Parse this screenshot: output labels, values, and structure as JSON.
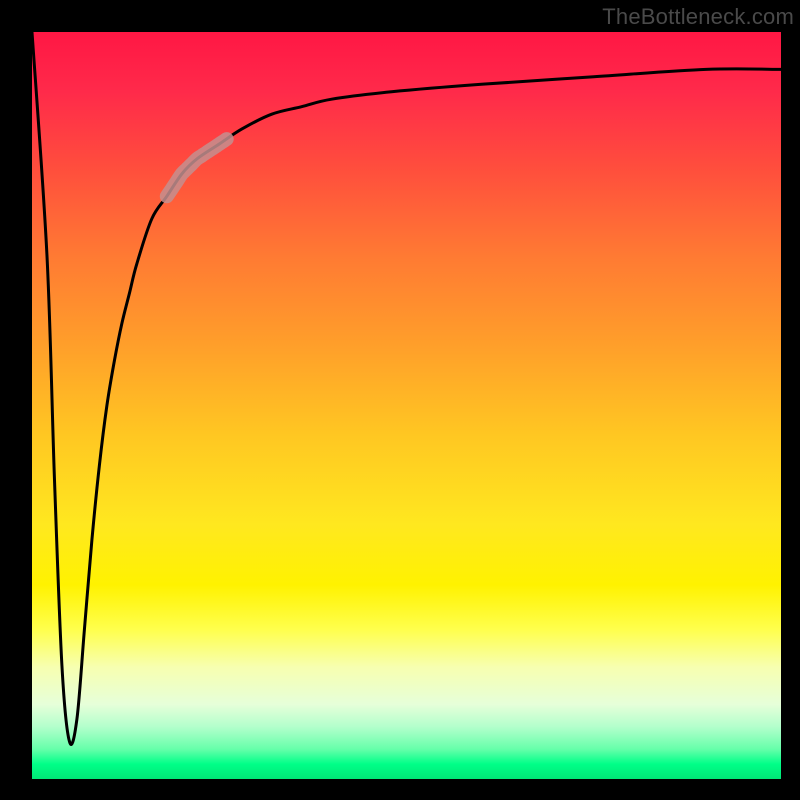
{
  "watermark": "TheBottleneck.com",
  "colors": {
    "background": "#000000",
    "curve": "#000000",
    "highlight": "#c48f8f"
  },
  "chart_data": {
    "type": "line",
    "title": "",
    "xlabel": "",
    "ylabel": "",
    "xlim": [
      0,
      100
    ],
    "ylim": [
      0,
      100
    ],
    "grid": false,
    "legend": false,
    "note": "y-axis inverted visually (0 at top, 100 at bottom of plot area); values estimated from pixel positions",
    "series": [
      {
        "name": "curve",
        "x": [
          0,
          2,
          3,
          4,
          5,
          6,
          7,
          8,
          9,
          10,
          11,
          12,
          13,
          14,
          16,
          18,
          20,
          22,
          25,
          28,
          32,
          36,
          40,
          48,
          60,
          75,
          90,
          100
        ],
        "y": [
          0,
          30,
          60,
          85,
          95,
          92,
          80,
          68,
          58,
          50,
          44,
          39,
          35,
          31,
          25,
          22,
          19,
          17,
          15,
          13,
          11,
          10,
          9,
          8,
          7,
          6,
          5,
          5
        ]
      }
    ],
    "highlight_segment": {
      "x_start": 18,
      "x_end": 26,
      "description": "thick pink stroke segment on the curve"
    }
  }
}
